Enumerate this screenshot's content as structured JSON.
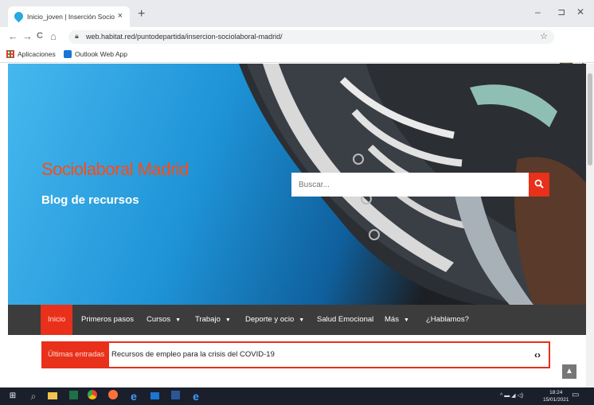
{
  "browser": {
    "tab_title": "Inicio_joven | Inserción Sociolab",
    "tab_close": "×",
    "new_tab": "+",
    "url": "web.habitat.red/puntodepartida/insercion-sociolaboral-madrid/",
    "back": "←",
    "forward": "→",
    "reload": "C",
    "home": "⌂",
    "minimize": "–",
    "maximize": "⊐",
    "close": "✕",
    "bookmarks": [
      {
        "label": "Aplicaciones",
        "icon": "apps-grid-icon"
      },
      {
        "label": "Outlook Web App",
        "icon": "outlook-icon"
      }
    ]
  },
  "site": {
    "title": "Sociolaboral Madrid",
    "subtitle": "Blog de recursos",
    "search_placeholder": "Buscar...",
    "nav": [
      {
        "label": "Inicio",
        "active": true,
        "dropdown": false
      },
      {
        "label": "Primeros pasos",
        "active": false,
        "dropdown": false
      },
      {
        "label": "Cursos",
        "active": false,
        "dropdown": true
      },
      {
        "label": "Trabajo",
        "active": false,
        "dropdown": true
      },
      {
        "label": "Deporte y ocio",
        "active": false,
        "dropdown": true
      },
      {
        "label": "Salud Emocional",
        "active": false,
        "dropdown": false
      },
      {
        "label": "Más",
        "active": false,
        "dropdown": true
      },
      {
        "label": "¿Hablamos?",
        "active": false,
        "dropdown": false
      }
    ],
    "ticker_label": "Últimas entradas",
    "ticker_text": "Recursos de empleo para la crisis del COVID-19",
    "ticker_arrows": "‹›"
  },
  "taskbar": {
    "time": "18:24",
    "date": "15/01/2021"
  },
  "colors": {
    "accent": "#e8301a",
    "title": "#ff4a14",
    "nav_bg": "#3c3c3c",
    "taskbar_bg": "#1a1f2b"
  }
}
